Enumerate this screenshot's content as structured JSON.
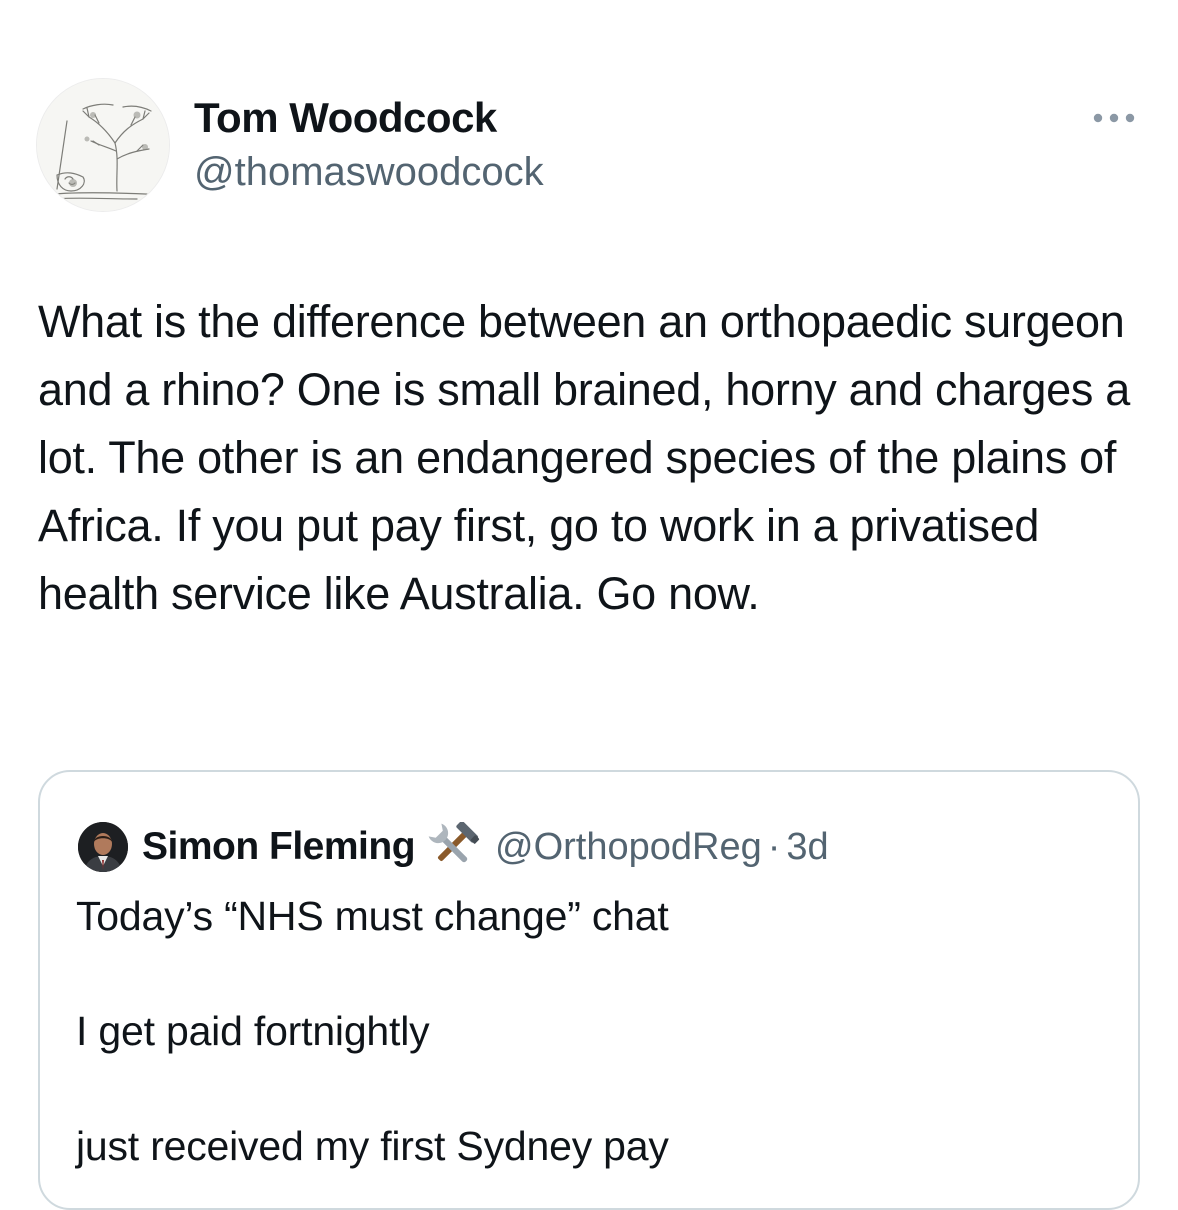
{
  "tweet": {
    "author": {
      "name": "Tom Woodcock",
      "handle": "@thomaswoodcock"
    },
    "text": "What is the difference between an orthopaedic surgeon and a rhino? One is small brained, horny and charges a lot. The other is an endangered species of the plains of Africa. If you put pay first, go to work in a privatised health service like Australia. Go now."
  },
  "quoted_tweet": {
    "author": {
      "name": "Simon Fleming",
      "handle": "@OrthopodReg",
      "separator": "·",
      "time": "3d"
    },
    "lines": [
      "Today’s “NHS must change” chat",
      "I get paid fortnightly",
      "just received my first Sydney pay"
    ]
  },
  "icons": {
    "more": "more-options-icon",
    "tools": "hammer-and-wrench-icon"
  },
  "colors": {
    "text": "#0f1419",
    "secondary": "#536471",
    "border": "#cfd9de"
  }
}
